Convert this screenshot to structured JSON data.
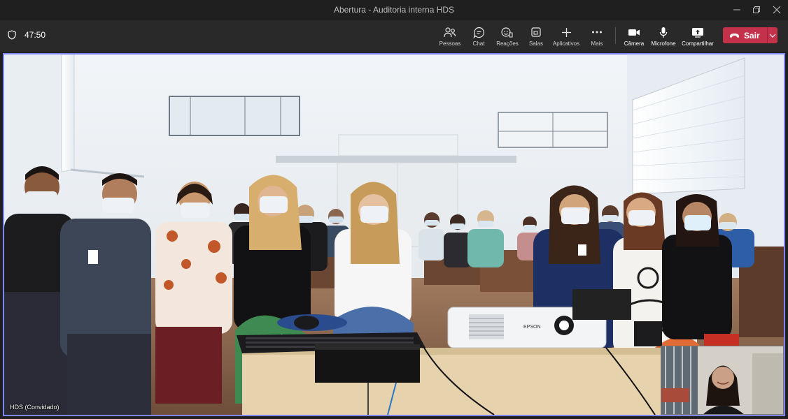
{
  "window": {
    "title": "Abertura - Auditoria interna HDS"
  },
  "toolbar": {
    "timer": "47:50",
    "buttons": [
      {
        "label": "Pessoas",
        "icon": "people-icon"
      },
      {
        "label": "Chat",
        "icon": "chat-icon"
      },
      {
        "label": "Reações",
        "icon": "reactions-icon"
      },
      {
        "label": "Salas",
        "icon": "rooms-icon"
      },
      {
        "label": "Aplicativos",
        "icon": "plus-icon"
      },
      {
        "label": "Mais",
        "icon": "more-icon"
      },
      {
        "label": "Câmera",
        "icon": "camera-icon"
      },
      {
        "label": "Microfone",
        "icon": "microphone-icon"
      },
      {
        "label": "Compartilhar",
        "icon": "share-icon"
      }
    ],
    "leave_label": "Sair"
  },
  "stage": {
    "participant_name": "HDS (Convidado)",
    "projector_brand": "EPSON"
  },
  "colors": {
    "accent": "#7f85f5",
    "leave": "#c4314b",
    "toolbar": "#292929",
    "titlebar": "#1f1f1f"
  }
}
